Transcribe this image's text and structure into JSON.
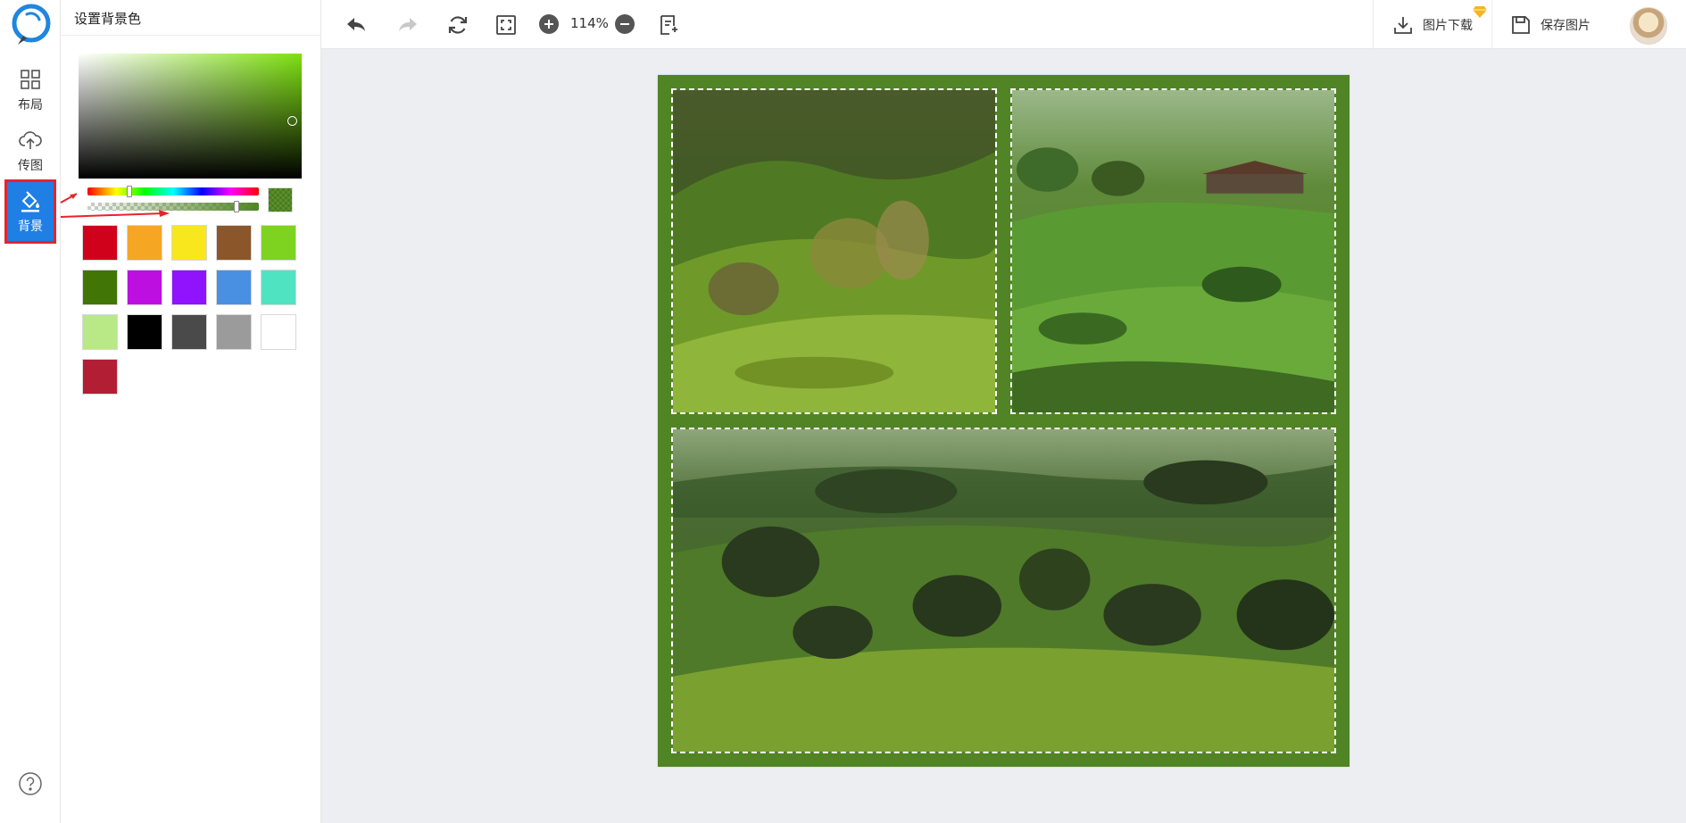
{
  "sidebar": {
    "items": [
      {
        "label": "布局",
        "icon": "grid-icon"
      },
      {
        "label": "传图",
        "icon": "cloud-upload-icon"
      },
      {
        "label": "背景",
        "icon": "paint-bucket-icon",
        "active": true
      }
    ],
    "help_icon": "help-icon"
  },
  "panel": {
    "title": "设置背景色",
    "current_color": "#508424",
    "swatches": [
      "#d0021b",
      "#f5a623",
      "#f8e71c",
      "#8b572a",
      "#7ed321",
      "#417505",
      "#bd10e0",
      "#9013fe",
      "#4a90e2",
      "#50e3c2",
      "#b8e986",
      "#000000",
      "#4a4a4a",
      "#9b9b9b",
      "#ffffff",
      "#b21f35"
    ]
  },
  "toolbar": {
    "zoom": "114%",
    "download_label": "图片下载",
    "save_label": "保存图片"
  },
  "canvas": {
    "background": "#508424"
  }
}
